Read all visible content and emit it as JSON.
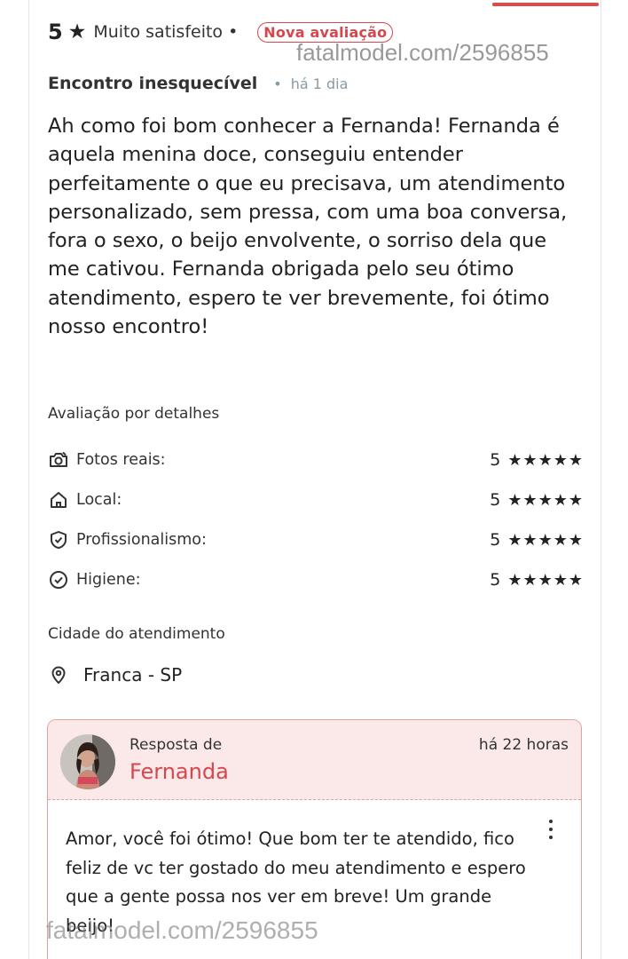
{
  "review": {
    "score": "5",
    "star_glyph": "★",
    "rating_label": "Muito satisfeito",
    "separator": "•",
    "badge": "Nova avaliação",
    "title": "Encontro inesquecível",
    "time": "há 1 dia",
    "body": "Ah como foi bom conhecer a Fernanda! Fernanda é aquela menina doce, conseguiu entender perfeitamente o que eu precisava, um atendimento personalizado, sem pressa, com uma boa conversa, fora o sexo, o beijo envolvente, o sorriso dela que me cativou. Fernanda obrigada pelo seu ótimo atendimento, espero te ver brevemente, foi ótimo nosso encontro!"
  },
  "watermark": {
    "top": "fatalmodel.com/2596855",
    "bottom": "fatalmodel.com/2596855"
  },
  "details": {
    "section_title": "Avaliação por detalhes",
    "items": [
      {
        "label": "Fotos reais:",
        "score": "5",
        "stars": "★★★★★",
        "rating": 5,
        "icon": "camera-icon"
      },
      {
        "label": "Local:",
        "score": "5",
        "stars": "★★★★★",
        "rating": 5,
        "icon": "home-icon"
      },
      {
        "label": "Profissionalismo:",
        "score": "5",
        "stars": "★★★★★",
        "rating": 5,
        "icon": "shield-check-icon"
      },
      {
        "label": "Higiene:",
        "score": "5",
        "stars": "★★★★★",
        "rating": 5,
        "icon": "check-circle-icon"
      }
    ]
  },
  "city": {
    "section_title": "Cidade do atendimento",
    "value": "Franca - SP",
    "icon": "location-pin-icon"
  },
  "reply": {
    "label": "Resposta de",
    "name": "Fernanda",
    "time": "há 22 horas",
    "body": "Amor, você foi ótimo! Que bom ter te atendido, fico feliz de vc ter gostado do meu atendimento e espero que a gente possa nos ver em breve! Um grande beijo!",
    "menu_icon": "more-vertical-icon"
  },
  "colors": {
    "accent": "#d6474d",
    "reply_bg": "#fbe9ea",
    "reply_border": "#e6a0a0",
    "muted": "#8a9aa5"
  }
}
